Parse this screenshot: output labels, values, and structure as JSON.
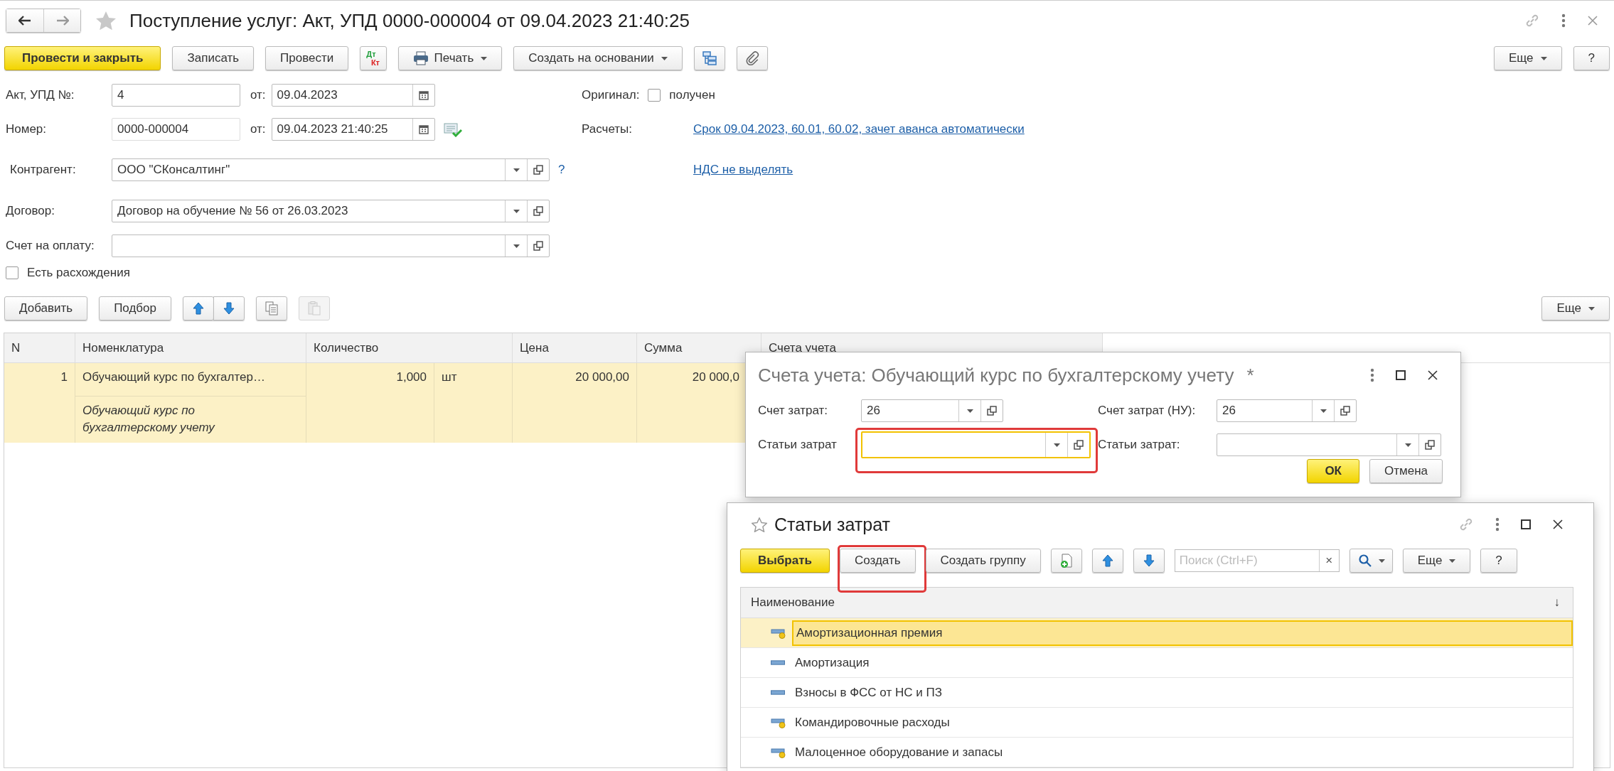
{
  "window": {
    "title": "Поступление услуг: Акт, УПД 0000-000004 от 09.04.2023 21:40:25"
  },
  "toolbar": [
    {
      "kind": "primary",
      "label": "Провести и закрыть"
    },
    {
      "kind": "button",
      "label": "Записать"
    },
    {
      "kind": "button",
      "label": "Провести"
    },
    {
      "kind": "dtkt",
      "label": "Дт",
      "label2": "Кт"
    },
    {
      "kind": "print",
      "label": "Печать"
    },
    {
      "kind": "menu",
      "label": "Создать на основании"
    },
    {
      "kind": "structure"
    },
    {
      "kind": "attach"
    }
  ],
  "toolbar_right": [
    {
      "kind": "menu",
      "label": "Еще"
    },
    {
      "kind": "button",
      "label": "?"
    }
  ],
  "form": {
    "act": {
      "label": "Акт, УПД №:",
      "value": "4",
      "date_label": "от:",
      "date": "09.04.2023"
    },
    "number": {
      "label": "Номер:",
      "value": "0000-000004",
      "date_label": "от:",
      "date": "09.04.2023 21:40:25"
    },
    "counterparty": {
      "label": "Контрагент:",
      "value": "ООО \"СКонсалтинг\"",
      "help": "?"
    },
    "contract": {
      "label": "Договор:",
      "value": "Договор на обучение № 56 от 26.03.2023"
    },
    "invoice": {
      "label": "Счет на оплату:"
    },
    "discrepancies": {
      "label": "Есть расхождения",
      "checked": false
    },
    "original": {
      "label": "Оригинал:",
      "checkbox_label": "получен",
      "checked": false
    },
    "settlements": {
      "label": "Расчеты:",
      "link": "Срок 09.04.2023, 60.01, 60.02, зачет аванса автоматически"
    },
    "vat_link": "НДС не выделять"
  },
  "table_toolbar": [
    {
      "kind": "button",
      "label": "Добавить"
    },
    {
      "kind": "button",
      "label": "Подбор"
    },
    {
      "kind": "up"
    },
    {
      "kind": "down"
    },
    {
      "kind": "copy",
      "disabled": false
    },
    {
      "kind": "paste",
      "disabled": true
    }
  ],
  "table_toolbar_right": [
    {
      "kind": "menu",
      "label": "Еще"
    }
  ],
  "table": {
    "columns": [
      "N",
      "Номенклатура",
      "Количество",
      "Цена",
      "Сумма",
      "Счета учета"
    ],
    "rows": [
      {
        "n": "1",
        "name": "Обучающий курс по бухгалтер…",
        "description": "Обучающий курс по бухгалтерскому учету",
        "quantity": "1,000",
        "unit": "шт",
        "price": "20 000,00",
        "sum": "20 000,0",
        "selected": true
      }
    ]
  },
  "accounts_dialog": {
    "title": "Счета учета: Обучающий курс по бухгалтерскому учету",
    "modified": "*",
    "left_fields": [
      {
        "label": "Счет затрат:",
        "value": "26",
        "focused": false
      },
      {
        "label": "Статьи затрат",
        "focused": true,
        "highlighted": true
      }
    ],
    "right_fields": [
      {
        "label": "Счет затрат (НУ):",
        "value": "26",
        "focused": false
      },
      {
        "label": "Статьи затрат:",
        "focused": false
      }
    ],
    "buttons": [
      {
        "kind": "primary",
        "label": "ОК"
      },
      {
        "kind": "button",
        "label": "Отмена"
      }
    ]
  },
  "cost_items_dialog": {
    "title": "Статьи затрат",
    "toolbar": [
      {
        "kind": "primary",
        "label": "Выбрать"
      },
      {
        "kind": "button",
        "label": "Создать",
        "highlighted": true
      },
      {
        "kind": "button",
        "label": "Создать группу"
      },
      {
        "kind": "newdoc"
      },
      {
        "kind": "up"
      },
      {
        "kind": "down"
      },
      {
        "kind": "search",
        "placeholder": "Поиск (Ctrl+F)",
        "clear": "×"
      },
      {
        "kind": "find"
      },
      {
        "kind": "menu",
        "label": "Еще"
      },
      {
        "kind": "button",
        "label": "?"
      }
    ],
    "list": {
      "column": "Наименование",
      "sort": "↓",
      "items": [
        {
          "name": "Амортизационная премия",
          "predefined": true,
          "selected": true
        },
        {
          "name": "Амортизация",
          "predefined": false,
          "selected": false
        },
        {
          "name": "Взносы в ФСС от НС и ПЗ",
          "predefined": false,
          "selected": false
        },
        {
          "name": "Командировочные расходы",
          "predefined": true,
          "selected": false
        },
        {
          "name": "Малоценное оборудование и запасы",
          "predefined": true,
          "selected": false
        }
      ]
    }
  }
}
